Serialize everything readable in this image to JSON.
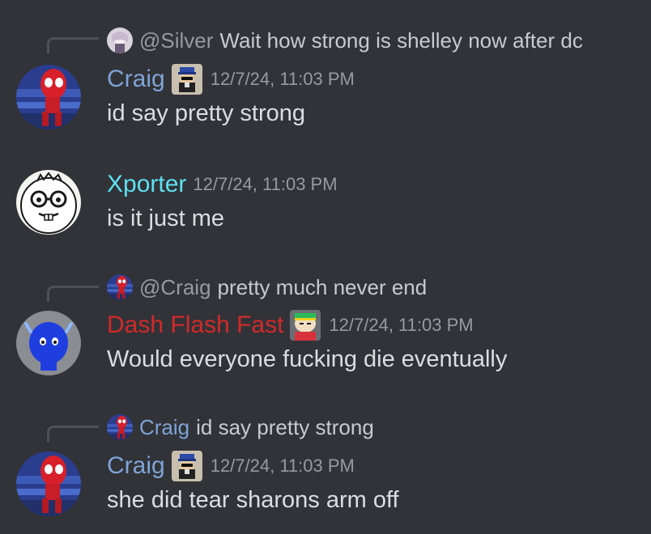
{
  "colors": {
    "background": "#313338",
    "craig_name": "#7fa3d6",
    "xporter_name": "#5ee0f0",
    "dash_name": "#d12a2a",
    "timestamp": "#949ba4",
    "mention": "#949ba4"
  },
  "messages": [
    {
      "reply": {
        "avatar": "silver-avatar",
        "name": "@Silver",
        "text": "Wait how strong is shelley now after dc"
      },
      "author": "Craig",
      "role_icon": "pixel-character-icon",
      "timestamp": "12/7/24, 11:03 PM",
      "content": "id say pretty strong"
    },
    {
      "author": "Xporter",
      "timestamp": "12/7/24, 11:03 PM",
      "content": "is it just me"
    },
    {
      "reply": {
        "avatar": "craig-avatar",
        "name": "@Craig",
        "text": "pretty much never end"
      },
      "author": "Dash Flash Fast",
      "role_icon": "cartoon-character-icon",
      "timestamp": "12/7/24, 11:03 PM",
      "content": "Would everyone fucking die eventually"
    },
    {
      "reply": {
        "avatar": "craig-avatar",
        "name": "Craig",
        "text": "id say pretty strong"
      },
      "author": "Craig",
      "role_icon": "pixel-character-icon",
      "timestamp": "12/7/24, 11:03 PM",
      "content": "she did tear sharons arm off"
    }
  ]
}
